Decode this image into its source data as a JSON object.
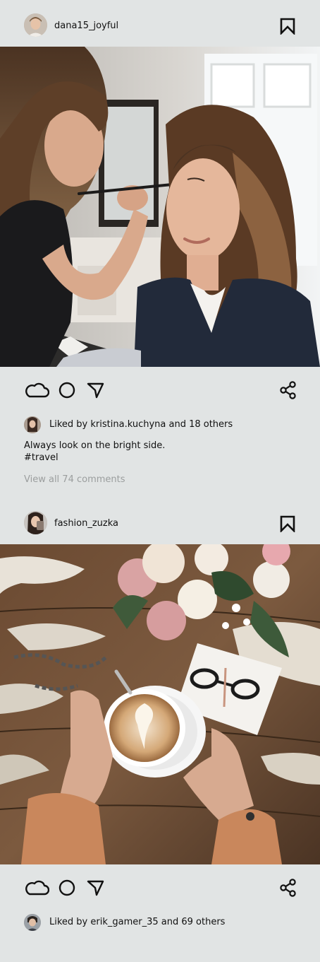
{
  "posts": [
    {
      "username": "dana15_joyful",
      "liked_by_prefix": "Liked by ",
      "liked_by_user": "kristina.kuchyna",
      "liked_by_suffix": " and 18 others",
      "caption": "Always look on the bright side.",
      "hashtag": "#travel",
      "comments_link": "View all 74 comments",
      "photo_alt": "Makeup artist applying eyeshadow to a woman"
    },
    {
      "username": "fashion_zuzka",
      "liked_by_prefix": "Liked by ",
      "liked_by_user": "erik_gamer_35",
      "liked_by_suffix": " and 69 others",
      "photo_alt": "Hands holding a latte next to flowers and glasses"
    }
  ],
  "icons": {
    "like": "cloud-icon",
    "comment": "circle-icon",
    "send": "paper-plane-icon",
    "share": "share-icon",
    "save": "bookmark-icon"
  },
  "colors": {
    "background": "#e1e4e4",
    "text": "#111111",
    "muted": "#9b9e9e"
  }
}
